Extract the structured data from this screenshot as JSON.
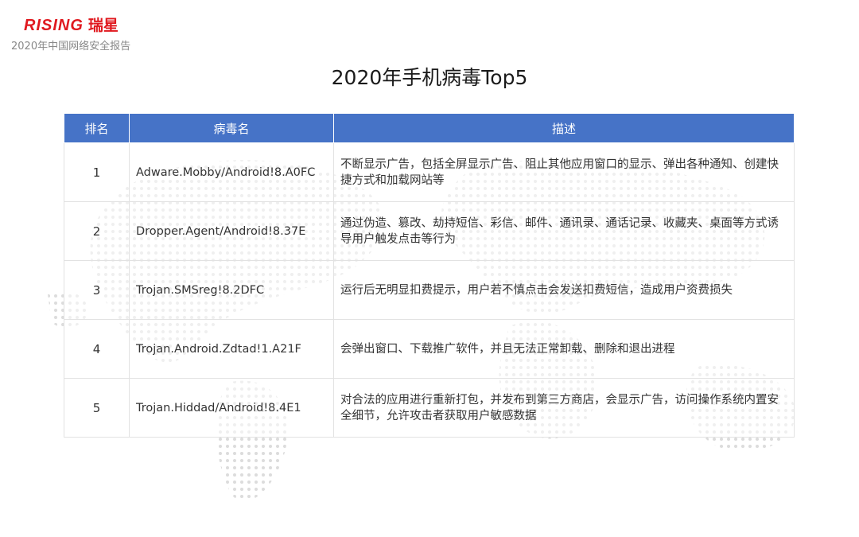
{
  "header": {
    "logo_en": "RISING",
    "logo_cn": "瑞星",
    "subtitle": "2020年中国网络安全报告"
  },
  "title": "2020年手机病毒Top5",
  "table": {
    "headers": [
      "排名",
      "病毒名",
      "描述"
    ],
    "rows": [
      {
        "rank": "1",
        "name": "Adware.Mobby/Android!8.A0FC",
        "desc": "不断显示广告，包括全屏显示广告、阻止其他应用窗口的显示、弹出各种通知、创建快捷方式和加载网站等"
      },
      {
        "rank": "2",
        "name": "Dropper.Agent/Android!8.37E",
        "desc": "通过伪造、篡改、劫持短信、彩信、邮件、通讯录、通话记录、收藏夹、桌面等方式诱导用户触发点击等行为"
      },
      {
        "rank": "3",
        "name": "Trojan.SMSreg!8.2DFC",
        "desc": "运行后无明显扣费提示，用户若不慎点击会发送扣费短信，造成用户资费损失"
      },
      {
        "rank": "4",
        "name": "Trojan.Android.Zdtad!1.A21F",
        "desc": "会弹出窗口、下载推广软件，并且无法正常卸载、删除和退出进程"
      },
      {
        "rank": "5",
        "name": "Trojan.Hiddad/Android!8.4E1",
        "desc": "对合法的应用进行重新打包，并发布到第三方商店，会显示广告，访问操作系统内置安全细节，允许攻击者获取用户敏感数据"
      }
    ]
  },
  "colors": {
    "brand_red": "#e0191f",
    "header_blue": "#4673c7"
  }
}
